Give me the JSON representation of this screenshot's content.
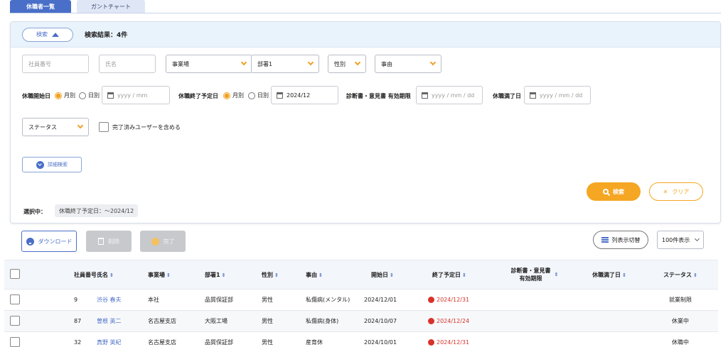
{
  "tabs": [
    {
      "label": "休職者一覧"
    },
    {
      "label": "ガントチャート"
    }
  ],
  "search_panel": {
    "toggle_label": "検索",
    "result_label": "検索結果：4件",
    "employee_no_placeholder": "社員番号",
    "name_placeholder": "氏名",
    "site_select": "事業場",
    "dept_select": "部署1",
    "sex_select": "性別",
    "reason_select": "事由",
    "leave_start_label": "休職開始日",
    "radio_monthly": "月別",
    "radio_daily": "日別",
    "leave_start_placeholder": "yyyy / mm",
    "leave_end_label": "休職終了予定日",
    "leave_end_value": "2024/12",
    "diag_label": "診断書・意見書 有効期限",
    "diag_placeholder": "yyyy / mm / dd",
    "expiry_label": "休職満了日",
    "expiry_placeholder": "yyyy / mm / dd",
    "status_select": "ステータス",
    "include_completed_label": "完了済みユーザーを含める",
    "detail_search_label": "詳細検索",
    "search_button": "検索",
    "clear_button": "クリア",
    "selected_label": "選択中：",
    "selected_chip": "休職終了予定日：～2024/12"
  },
  "actions": {
    "download": "ダウンロード",
    "delete": "削除",
    "complete": "完了",
    "columns": "列表示切替",
    "per_page": "100件表示"
  },
  "table": {
    "headers": {
      "id": "社員番号",
      "name": "氏名",
      "site": "事業場",
      "dept": "部署1",
      "sex": "性別",
      "reason": "事由",
      "start": "開始日",
      "end": "終了予定日",
      "diag_line1": "診断書・意見書",
      "diag_line2": "有効期限",
      "completion": "休職満了日",
      "status": "ステータス"
    },
    "rows": [
      {
        "id": "9",
        "name": "渋谷 春夫",
        "site": "本社",
        "dept": "品質保証部",
        "sex": "男性",
        "reason": "私傷病(メンタル)",
        "start": "2024/12/01",
        "end": "2024/12/31",
        "status": "就業制限"
      },
      {
        "id": "87",
        "name": "曽根 英二",
        "site": "名古屋支店",
        "dept": "大阪工場",
        "sex": "男性",
        "reason": "私傷病(身体)",
        "start": "2024/10/07",
        "end": "2024/12/24",
        "status": "休業中"
      },
      {
        "id": "32",
        "name": "真野 英紀",
        "site": "名古屋支店",
        "dept": "品質保証部",
        "sex": "男性",
        "reason": "産育休",
        "start": "2024/10/01",
        "end": "2024/12/31",
        "status": "休職中"
      }
    ]
  },
  "colors": {
    "primary": "#4a6fc9",
    "accent": "#f5a623",
    "danger": "#d8322a"
  }
}
